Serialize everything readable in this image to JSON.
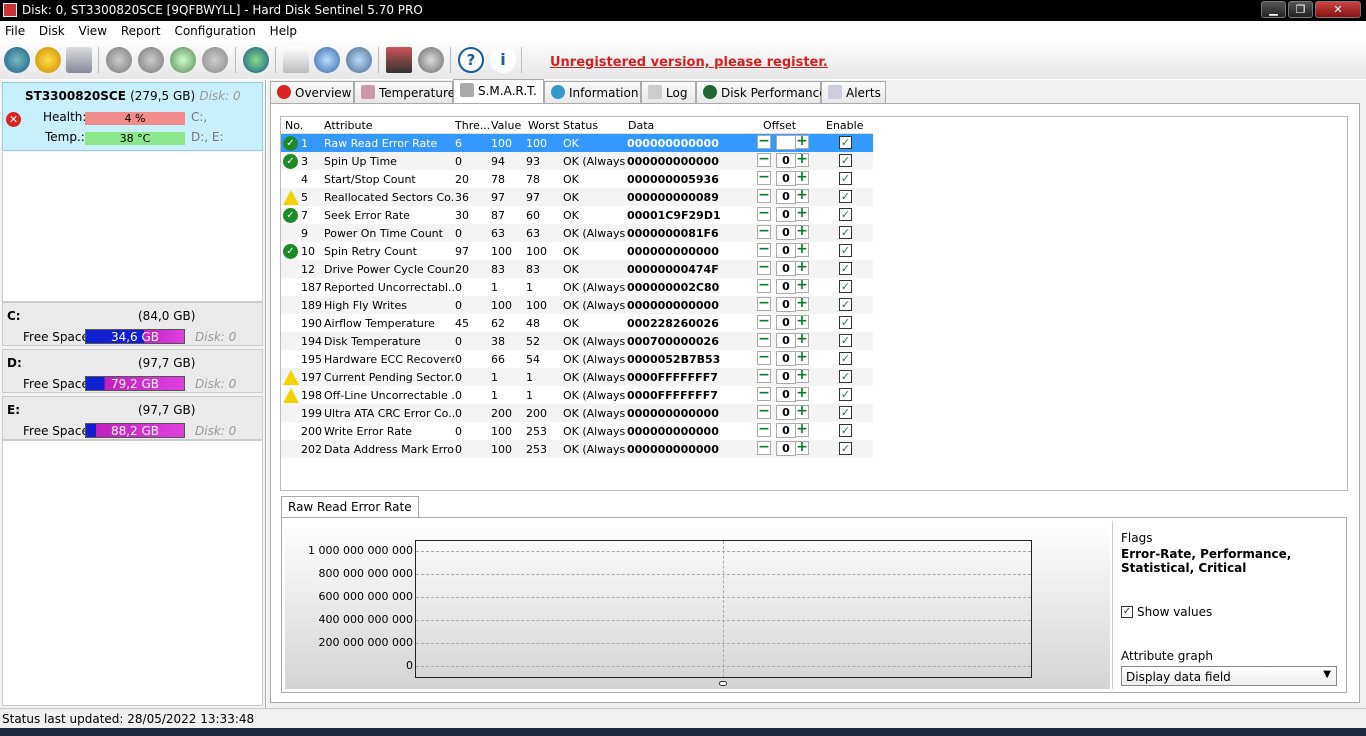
{
  "window": {
    "title": "Disk: 0, ST3300820SCE [9QFBWYLL]  -  Hard Disk Sentinel 5.70 PRO",
    "minimize": "▁",
    "maximize": "❐",
    "close": "✕"
  },
  "menu": [
    "File",
    "Disk",
    "View",
    "Report",
    "Configuration",
    "Help"
  ],
  "toolbar": {
    "unregistered": "Unregistered version, please register."
  },
  "disk": {
    "name": "ST3300820SCE",
    "size": "(279,5 GB)",
    "disk_label": "Disk: 0",
    "health_label": "Health:",
    "health_value": "4 %",
    "health_pct": 4,
    "health_drives": "C:,",
    "temp_label": "Temp.:",
    "temp_value": "38 °C",
    "temp_drives": "D:, E:"
  },
  "volumes": [
    {
      "letter": "C:",
      "size": "(84,0 GB)",
      "free_label": "Free Space",
      "free": "34,6 GB",
      "disk": "Disk: 0"
    },
    {
      "letter": "D:",
      "size": "(97,7 GB)",
      "free_label": "Free Space",
      "free": "79,2 GB",
      "disk": "Disk: 0"
    },
    {
      "letter": "E:",
      "size": "(97,7 GB)",
      "free_label": "Free Space",
      "free": "88,2 GB",
      "disk": "Disk: 0"
    }
  ],
  "tabs": [
    "Overview",
    "Temperature",
    "S.M.A.R.T.",
    "Information",
    "Log",
    "Disk Performance",
    "Alerts"
  ],
  "smart": {
    "headers": [
      "No.",
      "Attribute",
      "Thre...",
      "Value",
      "Worst",
      "Status",
      "Data",
      "Offset",
      "Enable"
    ],
    "rows": [
      {
        "icon": "ok",
        "no": "1",
        "attr": "Raw Read Error Rate",
        "thr": "6",
        "val": "100",
        "worst": "100",
        "status": "OK",
        "data": "000000000000",
        "offset": "0"
      },
      {
        "icon": "ok",
        "no": "3",
        "attr": "Spin Up Time",
        "thr": "0",
        "val": "94",
        "worst": "93",
        "status": "OK (Always...",
        "data": "000000000000",
        "offset": "0"
      },
      {
        "icon": "",
        "no": "4",
        "attr": "Start/Stop Count",
        "thr": "20",
        "val": "78",
        "worst": "78",
        "status": "OK",
        "data": "000000005936",
        "offset": "0"
      },
      {
        "icon": "warn",
        "no": "5",
        "attr": "Reallocated Sectors Co...",
        "thr": "36",
        "val": "97",
        "worst": "97",
        "status": "OK",
        "data": "000000000089",
        "offset": "0"
      },
      {
        "icon": "ok",
        "no": "7",
        "attr": "Seek Error Rate",
        "thr": "30",
        "val": "87",
        "worst": "60",
        "status": "OK",
        "data": "00001C9F29D1",
        "offset": "0"
      },
      {
        "icon": "",
        "no": "9",
        "attr": "Power On Time Count",
        "thr": "0",
        "val": "63",
        "worst": "63",
        "status": "OK (Always...",
        "data": "0000000081F6",
        "offset": "0"
      },
      {
        "icon": "ok",
        "no": "10",
        "attr": "Spin Retry Count",
        "thr": "97",
        "val": "100",
        "worst": "100",
        "status": "OK",
        "data": "000000000000",
        "offset": "0"
      },
      {
        "icon": "",
        "no": "12",
        "attr": "Drive Power Cycle Count",
        "thr": "20",
        "val": "83",
        "worst": "83",
        "status": "OK",
        "data": "00000000474F",
        "offset": "0"
      },
      {
        "icon": "",
        "no": "187",
        "attr": "Reported Uncorrectabl...",
        "thr": "0",
        "val": "1",
        "worst": "1",
        "status": "OK (Always...",
        "data": "000000002C80",
        "offset": "0"
      },
      {
        "icon": "",
        "no": "189",
        "attr": "High Fly Writes",
        "thr": "0",
        "val": "100",
        "worst": "100",
        "status": "OK (Always...",
        "data": "000000000000",
        "offset": "0"
      },
      {
        "icon": "",
        "no": "190",
        "attr": "Airflow Temperature",
        "thr": "45",
        "val": "62",
        "worst": "48",
        "status": "OK",
        "data": "000228260026",
        "offset": "0"
      },
      {
        "icon": "",
        "no": "194",
        "attr": "Disk Temperature",
        "thr": "0",
        "val": "38",
        "worst": "52",
        "status": "OK (Always...",
        "data": "000700000026",
        "offset": "0"
      },
      {
        "icon": "",
        "no": "195",
        "attr": "Hardware ECC Recovered",
        "thr": "0",
        "val": "66",
        "worst": "54",
        "status": "OK (Always...",
        "data": "0000052B7B53",
        "offset": "0"
      },
      {
        "icon": "warn",
        "no": "197",
        "attr": "Current Pending Sector...",
        "thr": "0",
        "val": "1",
        "worst": "1",
        "status": "OK (Always...",
        "data": "0000FFFFFFF7",
        "offset": "0"
      },
      {
        "icon": "warn",
        "no": "198",
        "attr": "Off-Line Uncorrectable ...",
        "thr": "0",
        "val": "1",
        "worst": "1",
        "status": "OK (Always...",
        "data": "0000FFFFFFF7",
        "offset": "0"
      },
      {
        "icon": "",
        "no": "199",
        "attr": "Ultra ATA CRC Error Co...",
        "thr": "0",
        "val": "200",
        "worst": "200",
        "status": "OK (Always...",
        "data": "000000000000",
        "offset": "0"
      },
      {
        "icon": "",
        "no": "200",
        "attr": "Write Error Rate",
        "thr": "0",
        "val": "100",
        "worst": "253",
        "status": "OK (Always...",
        "data": "000000000000",
        "offset": "0"
      },
      {
        "icon": "",
        "no": "202",
        "attr": "Data Address Mark Errors",
        "thr": "0",
        "val": "100",
        "worst": "253",
        "status": "OK (Always...",
        "data": "000000000000",
        "offset": "0"
      }
    ]
  },
  "graph": {
    "tab": "Raw Read Error Rate",
    "yticks": [
      "1 000 000 000 000",
      "800 000 000 000",
      "600 000 000 000",
      "400 000 000 000",
      "200 000 000 000",
      "0"
    ],
    "flags_label": "Flags",
    "flags_value": "Error-Rate, Performance, Statistical, Critical",
    "show_values": "Show values",
    "attr_graph_label": "Attribute graph",
    "attr_graph_value": "Display data field"
  },
  "status": "Status last updated: 28/05/2022 13:33:48",
  "colors": {
    "health": "#f28b8b",
    "temp": "#8de88d",
    "accent": "#3399ff",
    "unreg": "#d42020"
  }
}
